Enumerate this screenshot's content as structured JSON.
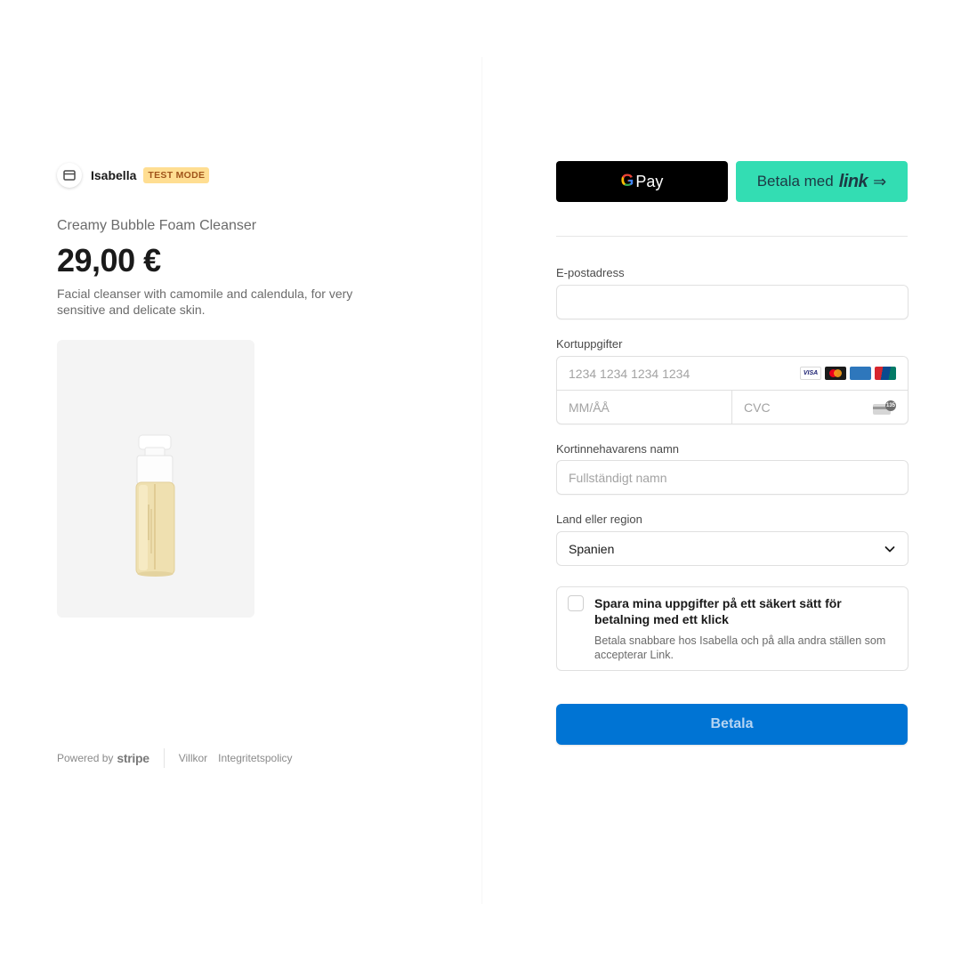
{
  "merchant": {
    "name": "Isabella",
    "badge": "TEST MODE"
  },
  "product": {
    "name": "Creamy Bubble Foam Cleanser",
    "price": "29,00 €",
    "description": "Facial cleanser with camomile and calendula, for very sensitive and delicate skin."
  },
  "footer": {
    "powered_by": "Powered by",
    "brand": "stripe",
    "terms": "Villkor",
    "privacy": "Integritetspolicy"
  },
  "wallets": {
    "gpay_g": "G",
    "gpay_label": "Pay",
    "link_prefix": "Betala med",
    "link_word": "link",
    "link_arrow": "⇒"
  },
  "form": {
    "email_label": "E-postadress",
    "email_value": "",
    "card_label": "Kortuppgifter",
    "card_number_placeholder": "1234 1234 1234 1234",
    "card_brands": [
      "VISA",
      "mastercard",
      "AMEX",
      "UnionPay"
    ],
    "expiry_placeholder": "MM/ÅÅ",
    "cvc_placeholder": "CVC",
    "cvc_badge": "135",
    "name_label": "Kortinnehavarens namn",
    "name_placeholder": "Fullständigt namn",
    "country_label": "Land eller region",
    "country_value": "Spanien"
  },
  "save_info": {
    "title": "Spara mina uppgifter på ett säkert sätt för betalning med ett klick",
    "description": "Betala snabbare hos Isabella och på alla andra ställen som accepterar Link.",
    "checked": false
  },
  "pay_button": {
    "label": "Betala"
  },
  "colors": {
    "pay_button": "#0074d4",
    "link_button": "#33ddb3",
    "gpay_button": "#000000",
    "test_badge_bg": "#ffde92",
    "test_badge_text": "#a0541a"
  }
}
